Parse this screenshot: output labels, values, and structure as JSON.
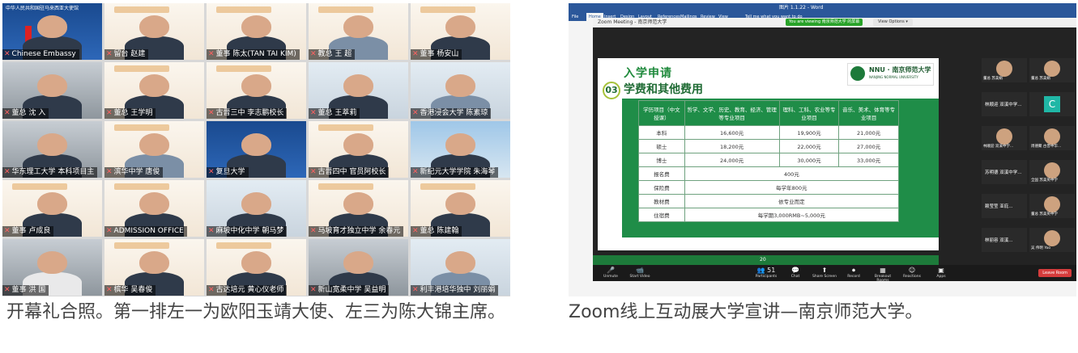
{
  "left": {
    "tiles": [
      {
        "name": "Chinese Embassy"
      },
      {
        "name": "留台 赵建"
      },
      {
        "name": "董事 陈太(TAN TAI KIM)"
      },
      {
        "name": "教总 王 超"
      },
      {
        "name": "董事 杨安山"
      },
      {
        "name": "董总 沈 入"
      },
      {
        "name": "董总 王学明"
      },
      {
        "name": "古晋三中 李志鹏校长"
      },
      {
        "name": "董总 王萃莉"
      },
      {
        "name": "香港浸会大学 陈素琼"
      },
      {
        "name": "华东理工大学 本科项目主"
      },
      {
        "name": "滨华中学 唐俊"
      },
      {
        "name": "复旦大学"
      },
      {
        "name": "古晋四中 官员阿校长"
      },
      {
        "name": "新纪元大学学院 朱海琴"
      },
      {
        "name": "董事 卢成良"
      },
      {
        "name": "ADMISSION OFFICE"
      },
      {
        "name": "麻坡中化中学 朝马梦"
      },
      {
        "name": "马坡育才独立中学 余春元"
      },
      {
        "name": "董总 陈建翰"
      },
      {
        "name": "董事 洪 国"
      },
      {
        "name": "槟华 吴春俊"
      },
      {
        "name": "古达培元 黄心仪老师"
      },
      {
        "name": "新山宽柔中学 吴益明"
      },
      {
        "name": "利丰港培华独中 刘丽娟"
      }
    ],
    "caption": "开幕礼合照。第一排左一为欧阳玉靖大使、左三为陈大锦主席。",
    "embassy_headline": "中华人民共和国驻马来西亚大使馆"
  },
  "right": {
    "word_title": "图片 1.1.22 - Word",
    "ribbon_tabs": [
      "File",
      "Home",
      "Insert",
      "Design",
      "Layout",
      "References",
      "Mailings",
      "Review",
      "View",
      "Tell me what you want to do"
    ],
    "zoom_title": "Zoom Meeting - 南京师范大学",
    "zoom_banner": "You are viewing 南京师范大学 的屏幕",
    "view_options": "View Options ▾",
    "slide": {
      "title": "入学申请",
      "section_num": "03",
      "section_title": "学费和其他费用",
      "logo_main": "NNU · 南京师范大学",
      "logo_sub": "NANJING NORMAL UNIVERSITY",
      "table": {
        "headers": [
          "学历项目（中文授课）",
          "哲学、文学、历史、教育、经济、管理等专业项目",
          "理科、工科、农业等专业项目",
          "音乐、美术、体育等专业项目"
        ],
        "rows": [
          [
            "本科",
            "16,600元",
            "19,900元",
            "21,000元"
          ],
          [
            "硕士",
            "18,200元",
            "22,000元",
            "27,000元"
          ],
          [
            "博士",
            "24,000元",
            "30,000元",
            "33,000元"
          ]
        ],
        "merged_rows": [
          [
            "报名费",
            "400元"
          ],
          [
            "保险费",
            "每学年800元"
          ],
          [
            "教材费",
            "依专业而定"
          ],
          [
            "住宿费",
            "每学期3,000RMB~5,000元"
          ]
        ]
      },
      "page_number": "20"
    },
    "gallery": [
      {
        "name": "董总 苏美娟"
      },
      {
        "name": "董总 苏美娟"
      },
      {
        "name": "林顺迎 双溪中学..."
      },
      {
        "name": "C"
      },
      {
        "name": "林顺迎 双溪中学..."
      },
      {
        "name": "周德聚 古晋中华..."
      },
      {
        "name": "苏明德 双溪中学..."
      },
      {
        "name": "全国 苏美英中学"
      },
      {
        "name": "赖莹莹 亚庇..."
      },
      {
        "name": "董总 苏美英中学"
      },
      {
        "name": "林丽容 双溪..."
      },
      {
        "name": "吴 伟明 Yoo"
      }
    ],
    "toolbar": {
      "items": [
        "Unmute",
        "Start Video",
        "Participants",
        "Chat",
        "Share Screen",
        "Record",
        "Breakout Rooms",
        "Reactions",
        "Apps"
      ],
      "participants_count": "51",
      "leave": "Leave Room"
    },
    "caption": "Zoom线上互动展大学宣讲—南京师范大学。"
  }
}
